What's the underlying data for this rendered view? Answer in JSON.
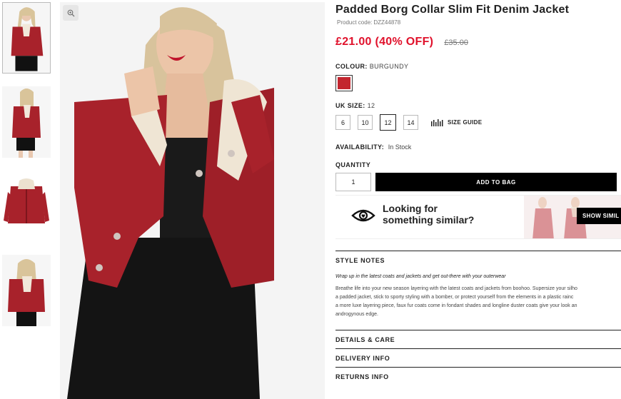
{
  "product": {
    "title": "Padded Borg Collar Slim Fit Denim Jacket",
    "code_label": "Product code:",
    "code": "DZZ44878",
    "price": "£21.00 (40% OFF)",
    "was_price": "£35.00"
  },
  "colour": {
    "label": "COLOUR:",
    "value": "BURGUNDY",
    "swatch_color": "#c3262f"
  },
  "size": {
    "label": "UK SIZE:",
    "value": "12",
    "options": [
      "6",
      "10",
      "12",
      "14"
    ],
    "selected": "12",
    "guide_label": "SIZE GUIDE"
  },
  "availability": {
    "label": "AVAILABILITY:",
    "value": "In Stock"
  },
  "quantity": {
    "label": "QUANTITY",
    "value": "1"
  },
  "add_to_bag": "ADD TO BAG",
  "similar": {
    "line1": "Looking for",
    "line2": "something similar?",
    "button": "SHOW SIMIL"
  },
  "style_notes": {
    "heading": "STYLE NOTES",
    "intro": "Wrap up in the latest coats and jackets and get out-there with your outerwear",
    "lines": [
      "Breathe life into your new season layering with the latest coats and jackets from boohoo. Supersize your silho",
      "a padded jacket, stick to sporty styling with a bomber, or protect yourself from the elements in a plastic rainc",
      "a more luxe layering piece, faux fur coats come in fondant shades and longline duster coats give your look an",
      "androgynous edge."
    ]
  },
  "accordions": [
    "DETAILS & CARE",
    "DELIVERY INFO",
    "RETURNS INFO"
  ],
  "colors": {
    "accent_red": "#e0112b",
    "jacket": "#a8222b",
    "button_bg": "#000000"
  }
}
